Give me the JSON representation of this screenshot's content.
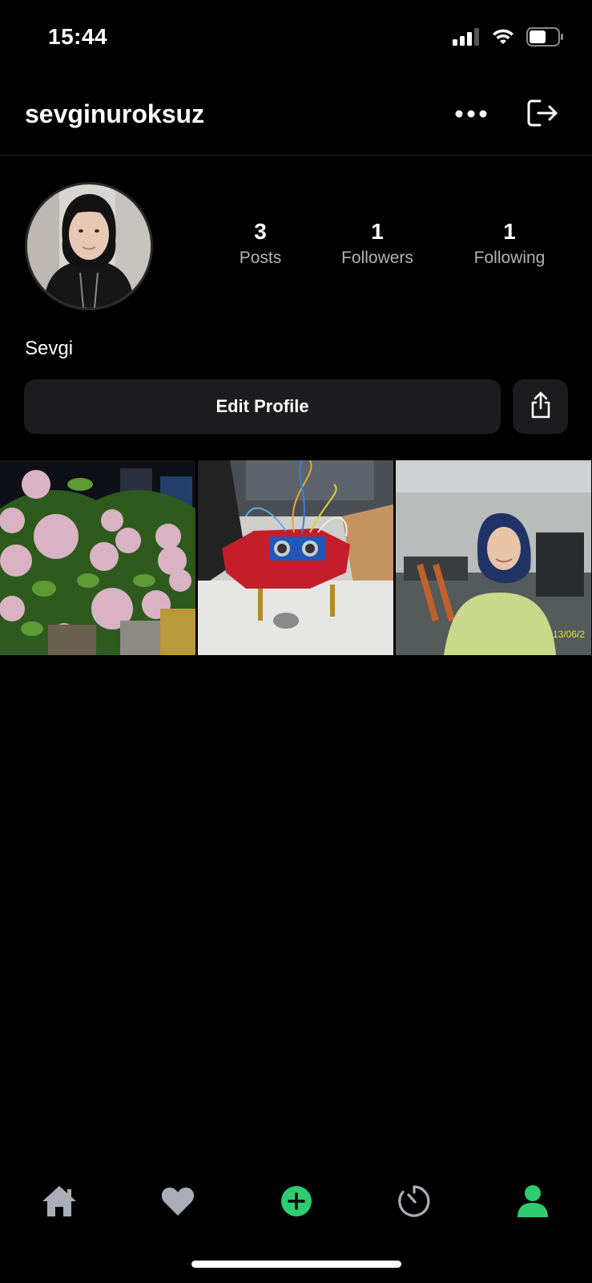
{
  "status_bar": {
    "time": "15:44",
    "icons": [
      "cellular-signal-icon",
      "wifi-icon",
      "battery-icon"
    ]
  },
  "header": {
    "username": "sevginuroksuz",
    "more_icon": "ellipsis-icon",
    "logout_icon": "logout-icon"
  },
  "profile": {
    "avatar": "profile-photo",
    "display_name": "Sevgi",
    "stats": [
      {
        "value": "3",
        "label": "Posts"
      },
      {
        "value": "1",
        "label": "Followers"
      },
      {
        "value": "1",
        "label": "Following"
      }
    ],
    "edit_button": "Edit Profile",
    "share_icon": "share-icon"
  },
  "posts": [
    {
      "subject": "hydrangea flowers"
    },
    {
      "subject": "red robot with ultrasonic sensor"
    },
    {
      "subject": "person in classroom",
      "date_stamp": "13/06/2"
    }
  ],
  "tab_bar": {
    "tabs": [
      {
        "icon": "home-icon",
        "active": false
      },
      {
        "icon": "heart-icon",
        "active": false
      },
      {
        "icon": "add-post-icon",
        "active": false
      },
      {
        "icon": "activity-timer-icon",
        "active": false
      },
      {
        "icon": "profile-icon",
        "active": true
      }
    ],
    "colors": {
      "inactive": "#a9adb8",
      "accent": "#2ecc71"
    }
  },
  "colors": {
    "background": "#000000",
    "surface": "#1c1c1e",
    "secondary_text": "#b3b3b3"
  }
}
